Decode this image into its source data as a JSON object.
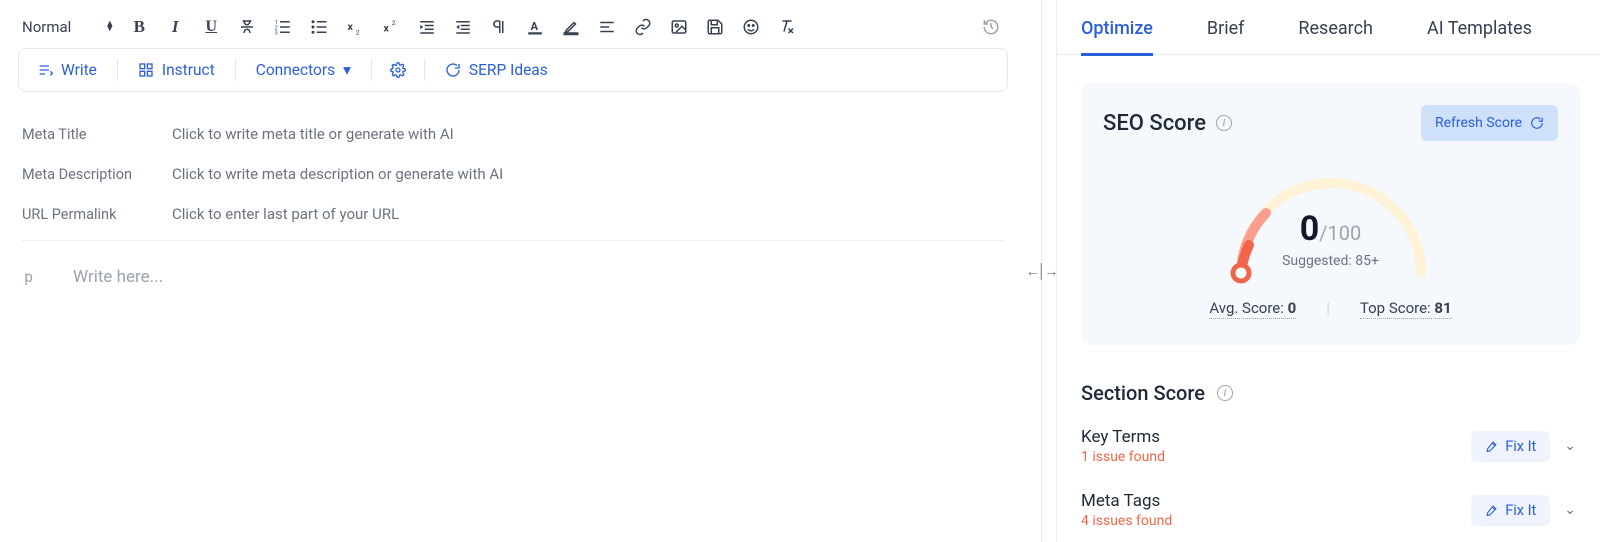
{
  "toolbar": {
    "format_label": "Normal"
  },
  "action_bar": {
    "write": "Write",
    "instruct": "Instruct",
    "connectors": "Connectors",
    "serp": "SERP Ideas"
  },
  "meta": {
    "title_label": "Meta Title",
    "title_placeholder": "Click to write meta title or generate with AI",
    "desc_label": "Meta Description",
    "desc_placeholder": "Click to write meta description or generate with AI",
    "url_label": "URL Permalink",
    "url_placeholder": "Click to enter last part of your URL"
  },
  "body": {
    "tag": "p",
    "placeholder": "Write here..."
  },
  "tabs": {
    "optimize": "Optimize",
    "brief": "Brief",
    "research": "Research",
    "ai": "AI Templates"
  },
  "seo": {
    "score_title": "SEO Score",
    "refresh": "Refresh Score",
    "score_value": "0",
    "score_denom": "/100",
    "suggested": "Suggested: 85+",
    "avg_label": "Avg. Score: ",
    "avg_value": "0",
    "top_label": "Top Score: ",
    "top_value": "81"
  },
  "section_score": {
    "title": "Section Score",
    "items": [
      {
        "name": "Key Terms",
        "issues": "1 issue found"
      },
      {
        "name": "Meta Tags",
        "issues": "4 issues found"
      }
    ],
    "fix_it": "Fix It"
  }
}
